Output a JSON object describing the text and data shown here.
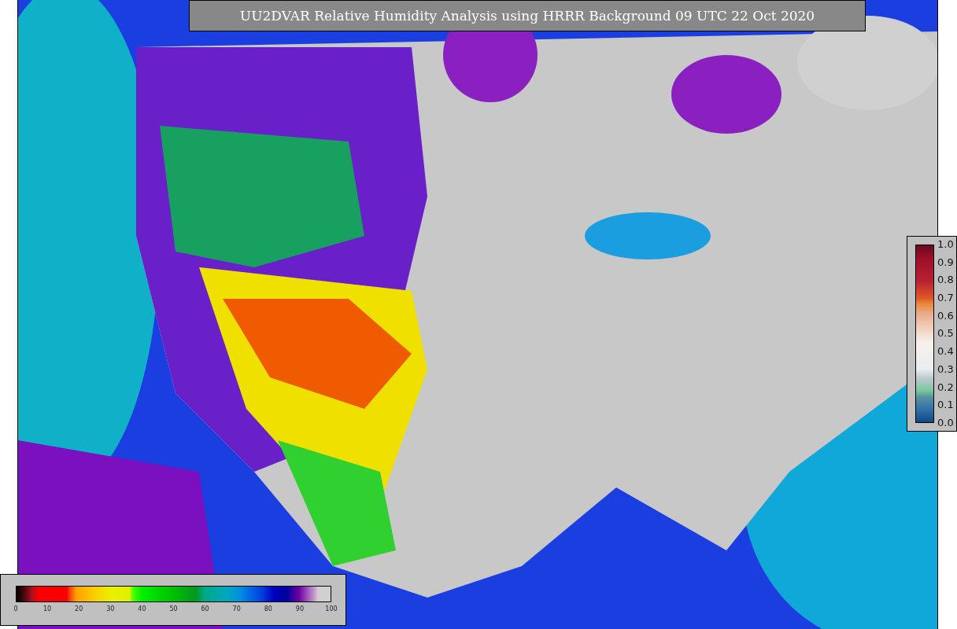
{
  "title": "UU2DVAR Relative Humidity Analysis using HRRR Background 09 UTC 22 Oct 2020",
  "humidity_colorbar": {
    "ticks": [
      "0",
      "10",
      "20",
      "30",
      "40",
      "50",
      "60",
      "70",
      "80",
      "90",
      "100"
    ]
  },
  "ratio_colorbar": {
    "ticks": [
      "1.0",
      "0.9",
      "0.8",
      "0.7",
      "0.6",
      "0.5",
      "0.4",
      "0.3",
      "0.2",
      "0.1",
      "0.0"
    ]
  }
}
